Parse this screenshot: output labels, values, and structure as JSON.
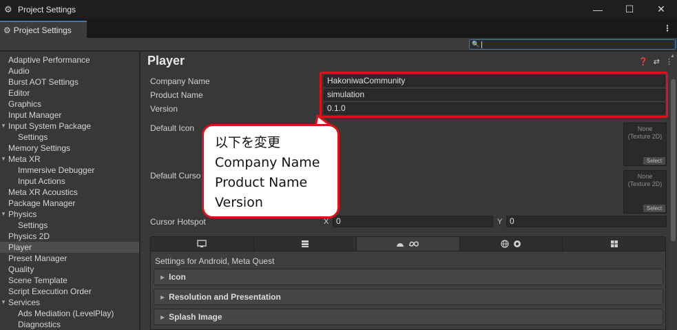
{
  "window": {
    "title": "Project Settings",
    "controls": {
      "minimize": "—",
      "maximize": "☐",
      "close": "✕"
    }
  },
  "tab": {
    "label": "Project Settings",
    "icon": "gear-icon"
  },
  "sidebar": {
    "items": [
      {
        "label": "Adaptive Performance",
        "level": 0
      },
      {
        "label": "Audio",
        "level": 0
      },
      {
        "label": "Burst AOT Settings",
        "level": 0
      },
      {
        "label": "Editor",
        "level": 0
      },
      {
        "label": "Graphics",
        "level": 0
      },
      {
        "label": "Input Manager",
        "level": 0
      },
      {
        "label": "Input System Package",
        "level": 0,
        "expanded": true
      },
      {
        "label": "Settings",
        "level": 1
      },
      {
        "label": "Memory Settings",
        "level": 0
      },
      {
        "label": "Meta XR",
        "level": 0,
        "expanded": true
      },
      {
        "label": "Immersive Debugger",
        "level": 1
      },
      {
        "label": "Input Actions",
        "level": 1
      },
      {
        "label": "Meta XR Acoustics",
        "level": 0
      },
      {
        "label": "Package Manager",
        "level": 0
      },
      {
        "label": "Physics",
        "level": 0,
        "expanded": true
      },
      {
        "label": "Settings",
        "level": 1
      },
      {
        "label": "Physics 2D",
        "level": 0
      },
      {
        "label": "Player",
        "level": 0,
        "selected": true
      },
      {
        "label": "Preset Manager",
        "level": 0
      },
      {
        "label": "Quality",
        "level": 0
      },
      {
        "label": "Scene Template",
        "level": 0
      },
      {
        "label": "Script Execution Order",
        "level": 0
      },
      {
        "label": "Services",
        "level": 0,
        "expanded": true
      },
      {
        "label": "Ads Mediation (LevelPlay)",
        "level": 1
      },
      {
        "label": "Diagnostics",
        "level": 1
      }
    ]
  },
  "main": {
    "title": "Player",
    "fields": {
      "company_name": {
        "label": "Company Name",
        "value": "HakoniwaCommunity"
      },
      "product_name": {
        "label": "Product Name",
        "value": "simulation"
      },
      "version": {
        "label": "Version",
        "value": "0.1.0"
      }
    },
    "default_icon": {
      "label": "Default Icon",
      "none_text": "None\n(Texture 2D)",
      "select": "Select"
    },
    "default_cursor": {
      "label": "Default Curso",
      "none_text": "None\n(Texture 2D)",
      "select": "Select"
    },
    "cursor_hotspot": {
      "label": "Cursor Hotspot",
      "x_label": "X",
      "x_value": "0",
      "y_label": "Y",
      "y_value": "0"
    },
    "platform_tabs": [
      {
        "icon": "monitor-icon",
        "active": false
      },
      {
        "icon": "server-icon",
        "active": false
      },
      {
        "icon": "android-meta-icon",
        "active": true
      },
      {
        "icon": "webgl-icon",
        "active": false
      },
      {
        "icon": "windows-icon",
        "active": false
      }
    ],
    "settings_for": "Settings for Android, Meta Quest",
    "foldouts": [
      "Icon",
      "Resolution and Presentation",
      "Splash Image"
    ]
  },
  "callout": {
    "lines": [
      "以下を変更",
      "Company Name",
      "Product Name",
      "Version"
    ],
    "border_color": "#e0101a"
  },
  "colors": {
    "highlight_red": "#e0101a",
    "accent_blue": "#3a79bb"
  }
}
